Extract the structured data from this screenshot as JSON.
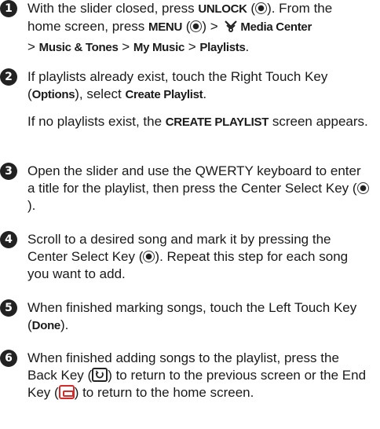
{
  "steps": [
    {
      "number": "1",
      "parts": {
        "a": "With the slider closed, press ",
        "b": "UNLOCK",
        "c": " (",
        "d": "). From the home screen, press ",
        "e": "MENU",
        "f": " (",
        "g": ") > ",
        "h": "Media Center",
        "i": " > ",
        "j": "Music & Tones",
        "k": " > ",
        "l": "My Music",
        "m": " > ",
        "n": "Playlists",
        "o": "."
      }
    },
    {
      "number": "2",
      "parts": {
        "a": "If playlists already exist, touch the Right Touch Key (",
        "b": "Options",
        "c": "), select ",
        "d": "Create Playlist",
        "e": "."
      },
      "para2": {
        "a": "If no playlists exist, the ",
        "b": "CREATE PLAYLIST",
        "c": " screen appears."
      }
    },
    {
      "number": "3",
      "parts": {
        "a": "Open the slider and use the QWERTY keyboard to enter a title for the playlist, then press the Center Select Key (",
        "b": ")."
      }
    },
    {
      "number": "4",
      "parts": {
        "a": "Scroll to a desired song and mark it by pressing the Center Select Key (",
        "b": "). Repeat this step for each song you want to add."
      }
    },
    {
      "number": "5",
      "parts": {
        "a": "When finished marking songs, touch the Left Touch Key (",
        "b": "Done",
        "c": ")."
      }
    },
    {
      "number": "6",
      "parts": {
        "a": "When finished adding songs to the playlist, press the Back Key (",
        "b": ") to return to the previous screen or the End Key (",
        "c": ") to return to the home screen."
      }
    }
  ],
  "icons": {
    "number_bullet": "circled-number-icon",
    "center_select": "center-select-key-icon",
    "media_center": "media-center-icon",
    "back_key": "back-key-icon",
    "end_key": "end-key-icon"
  },
  "colors": {
    "end_key": "#d32a2a",
    "text": "#1a1a1a"
  }
}
